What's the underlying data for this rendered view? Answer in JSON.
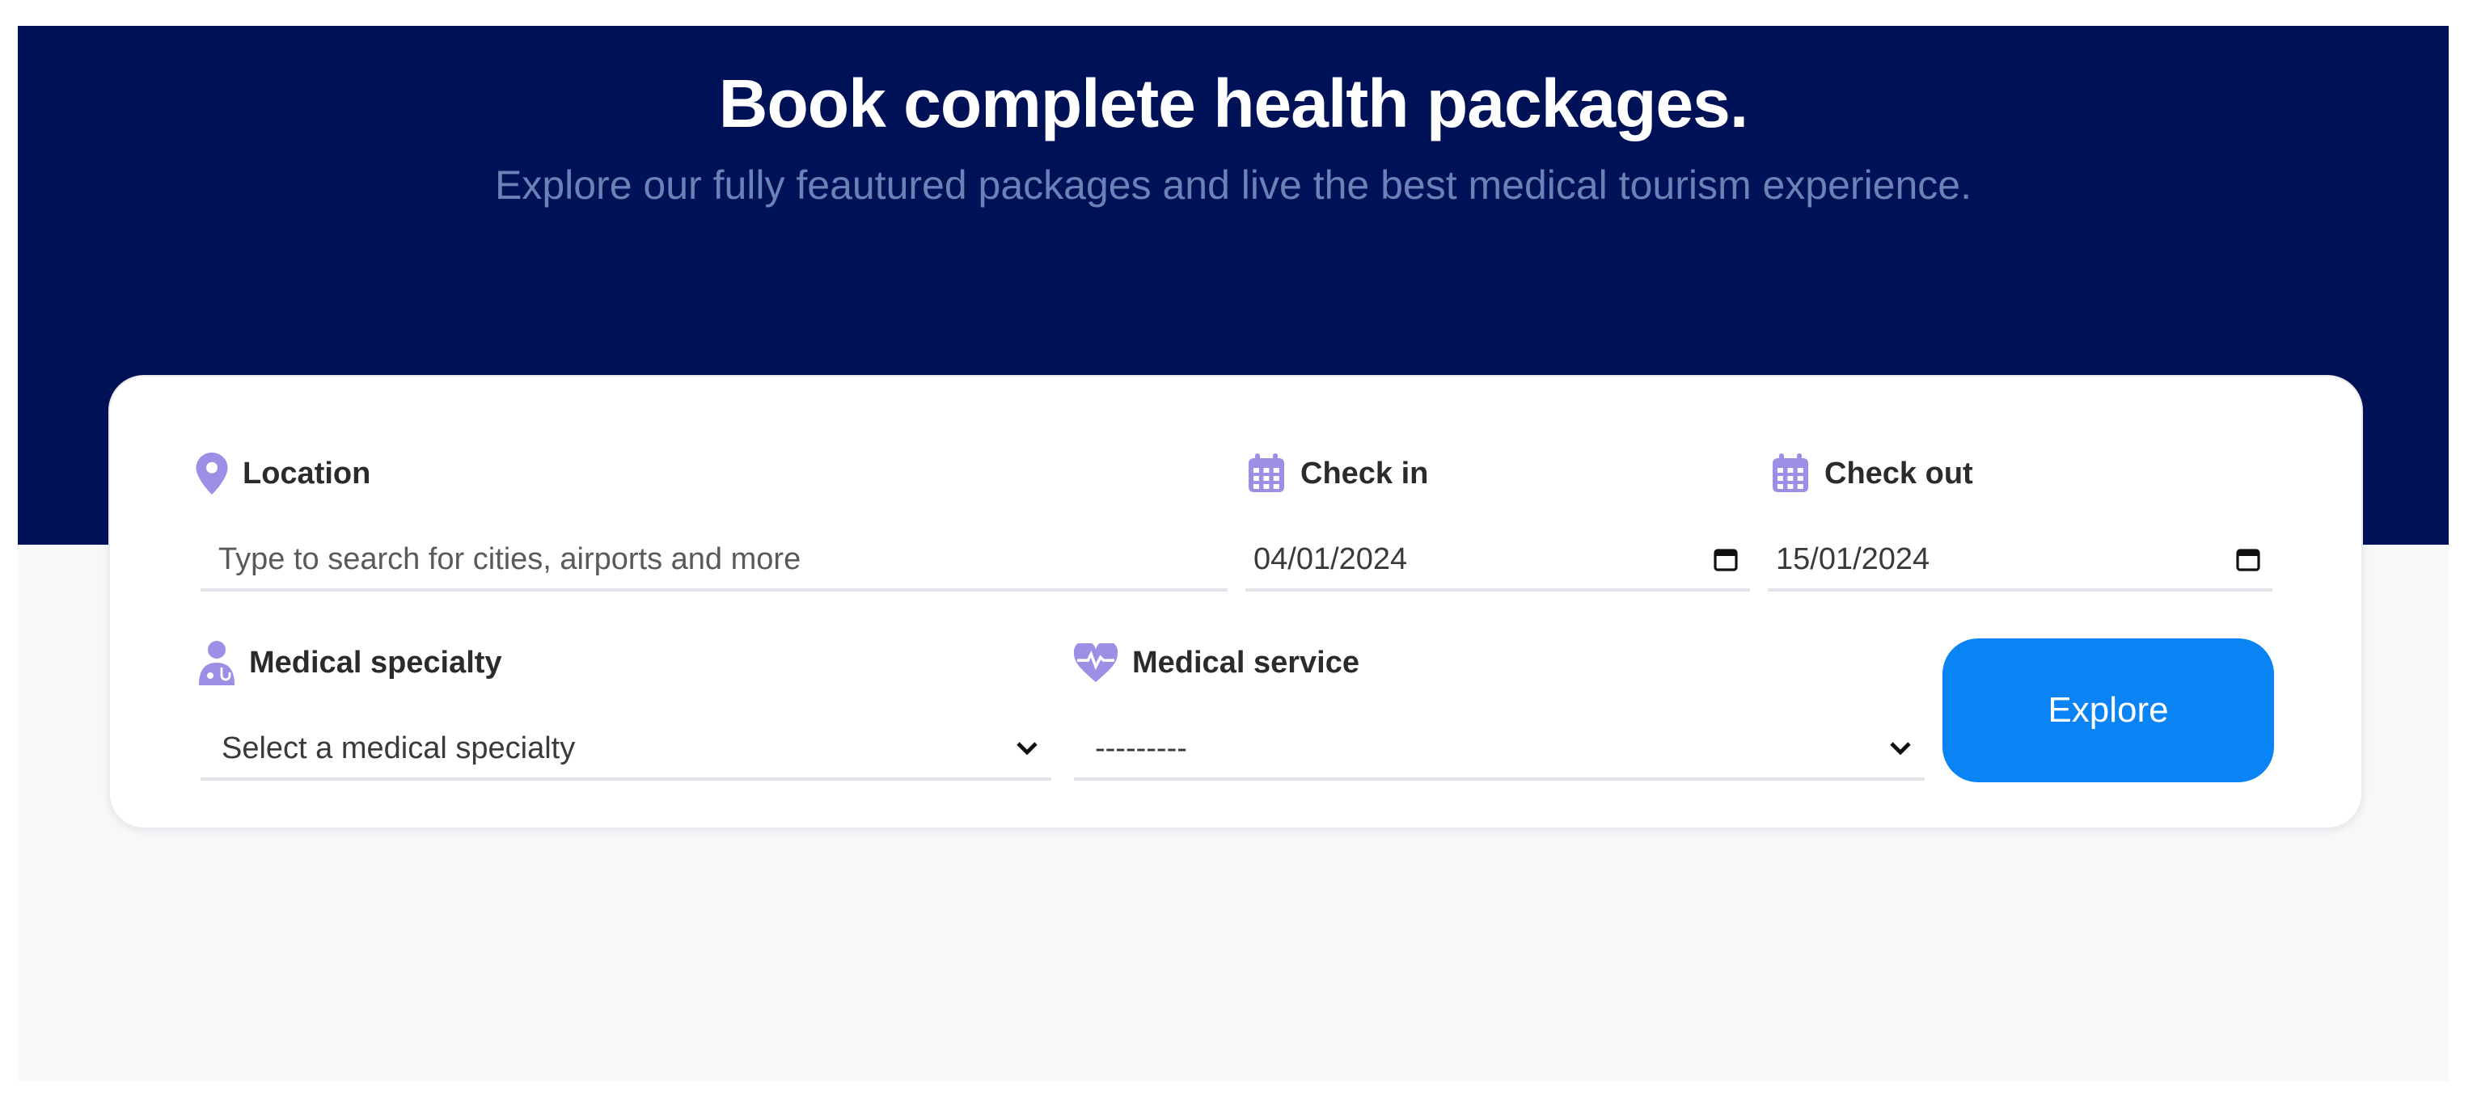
{
  "hero": {
    "title": "Book complete health packages.",
    "subtitle": "Explore our fully feautured packages and live the best medical tourism experience."
  },
  "form": {
    "location": {
      "label": "Location",
      "icon": "map-pin-icon",
      "placeholder": "Type to search for cities, airports and more"
    },
    "check_in": {
      "label": "Check in",
      "icon": "calendar-icon",
      "value": "04/01/2024"
    },
    "check_out": {
      "label": "Check out",
      "icon": "calendar-icon",
      "value": "15/01/2024"
    },
    "medical_specialty": {
      "label": "Medical specialty",
      "icon": "doctor-icon",
      "value": "Select a medical specialty"
    },
    "medical_service": {
      "label": "Medical service",
      "icon": "heartbeat-icon",
      "value": "---------"
    },
    "explore_label": "Explore"
  },
  "colors": {
    "hero_bg": "#001257",
    "accent_icon": "#9b8fe6",
    "button": "#0a84f5"
  }
}
